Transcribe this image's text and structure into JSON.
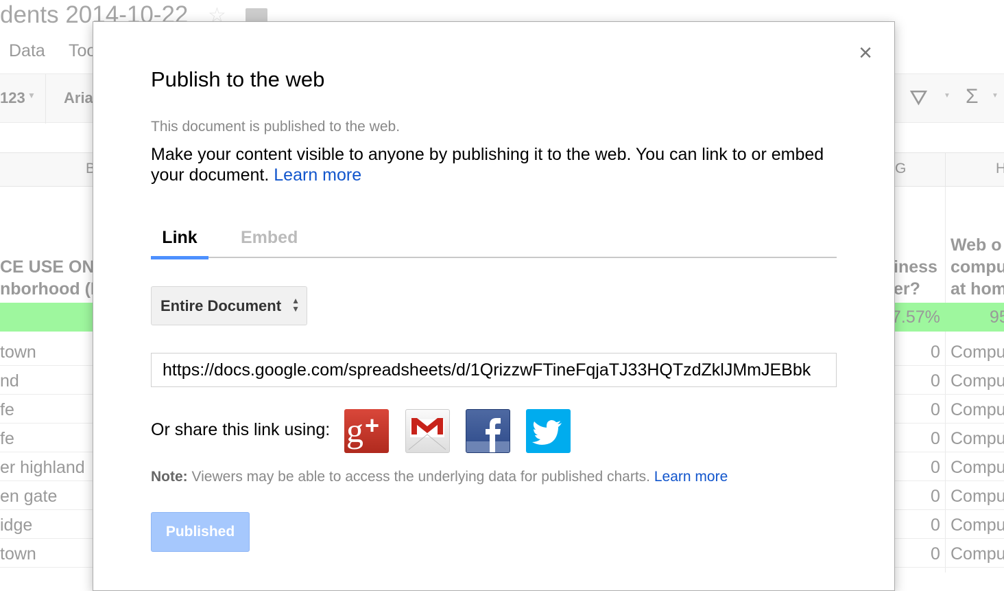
{
  "doc": {
    "title": "dents 2014-10-22",
    "star_icon": "star-icon",
    "folder_icon": "folder-icon"
  },
  "menu": [
    "Data",
    "Too"
  ],
  "toolbar": {
    "format": "123",
    "font": "Aria"
  },
  "columns": {
    "b": "B",
    "g": "G",
    "h": "H"
  },
  "headers": {
    "left1": "CE USE ON",
    "left2": "nborhood (I",
    "g1": "iness",
    "g2": "er?",
    "h1": "Web o",
    "h2": "compu",
    "h3": "at hom"
  },
  "highlight": {
    "g": "7.57%",
    "h": "95",
    "color": "#7ef57e"
  },
  "rows": [
    {
      "left": "town",
      "g": "0",
      "h": "Compu"
    },
    {
      "left": "nd",
      "g": "0",
      "h": "Compu"
    },
    {
      "left": "fe",
      "g": "0",
      "h": "Compu"
    },
    {
      "left": "fe",
      "g": "0",
      "h": "Compu"
    },
    {
      "left": "er highland",
      "g": "0",
      "h": "Compu"
    },
    {
      "left": "en gate",
      "g": "0",
      "h": "Compu"
    },
    {
      "left": "idge",
      "g": "0",
      "h": "Compu"
    },
    {
      "left": "town",
      "g": "0",
      "h": "Compu"
    }
  ],
  "dialog": {
    "title": "Publish to the web",
    "close": "×",
    "status": "This document is published to the web.",
    "description": "Make your content visible to anyone by publishing it to the web. You can link to or embed your document.",
    "learn_more": "Learn more",
    "tabs": [
      "Link",
      "Embed"
    ],
    "scope": "Entire Document",
    "url": "https://docs.google.com/spreadsheets/d/1QrizzwFTineFqjaTJ33HQTzdZklJMmJEBbk",
    "share_label": "Or share this link using:",
    "share": [
      "google-plus",
      "gmail",
      "facebook",
      "twitter"
    ],
    "note_label": "Note:",
    "note": "Viewers may be able to access the underlying data for published charts.",
    "note_link": "Learn more",
    "published_button": "Published",
    "accent": "#4d90fe",
    "link_color": "#1155cc"
  }
}
